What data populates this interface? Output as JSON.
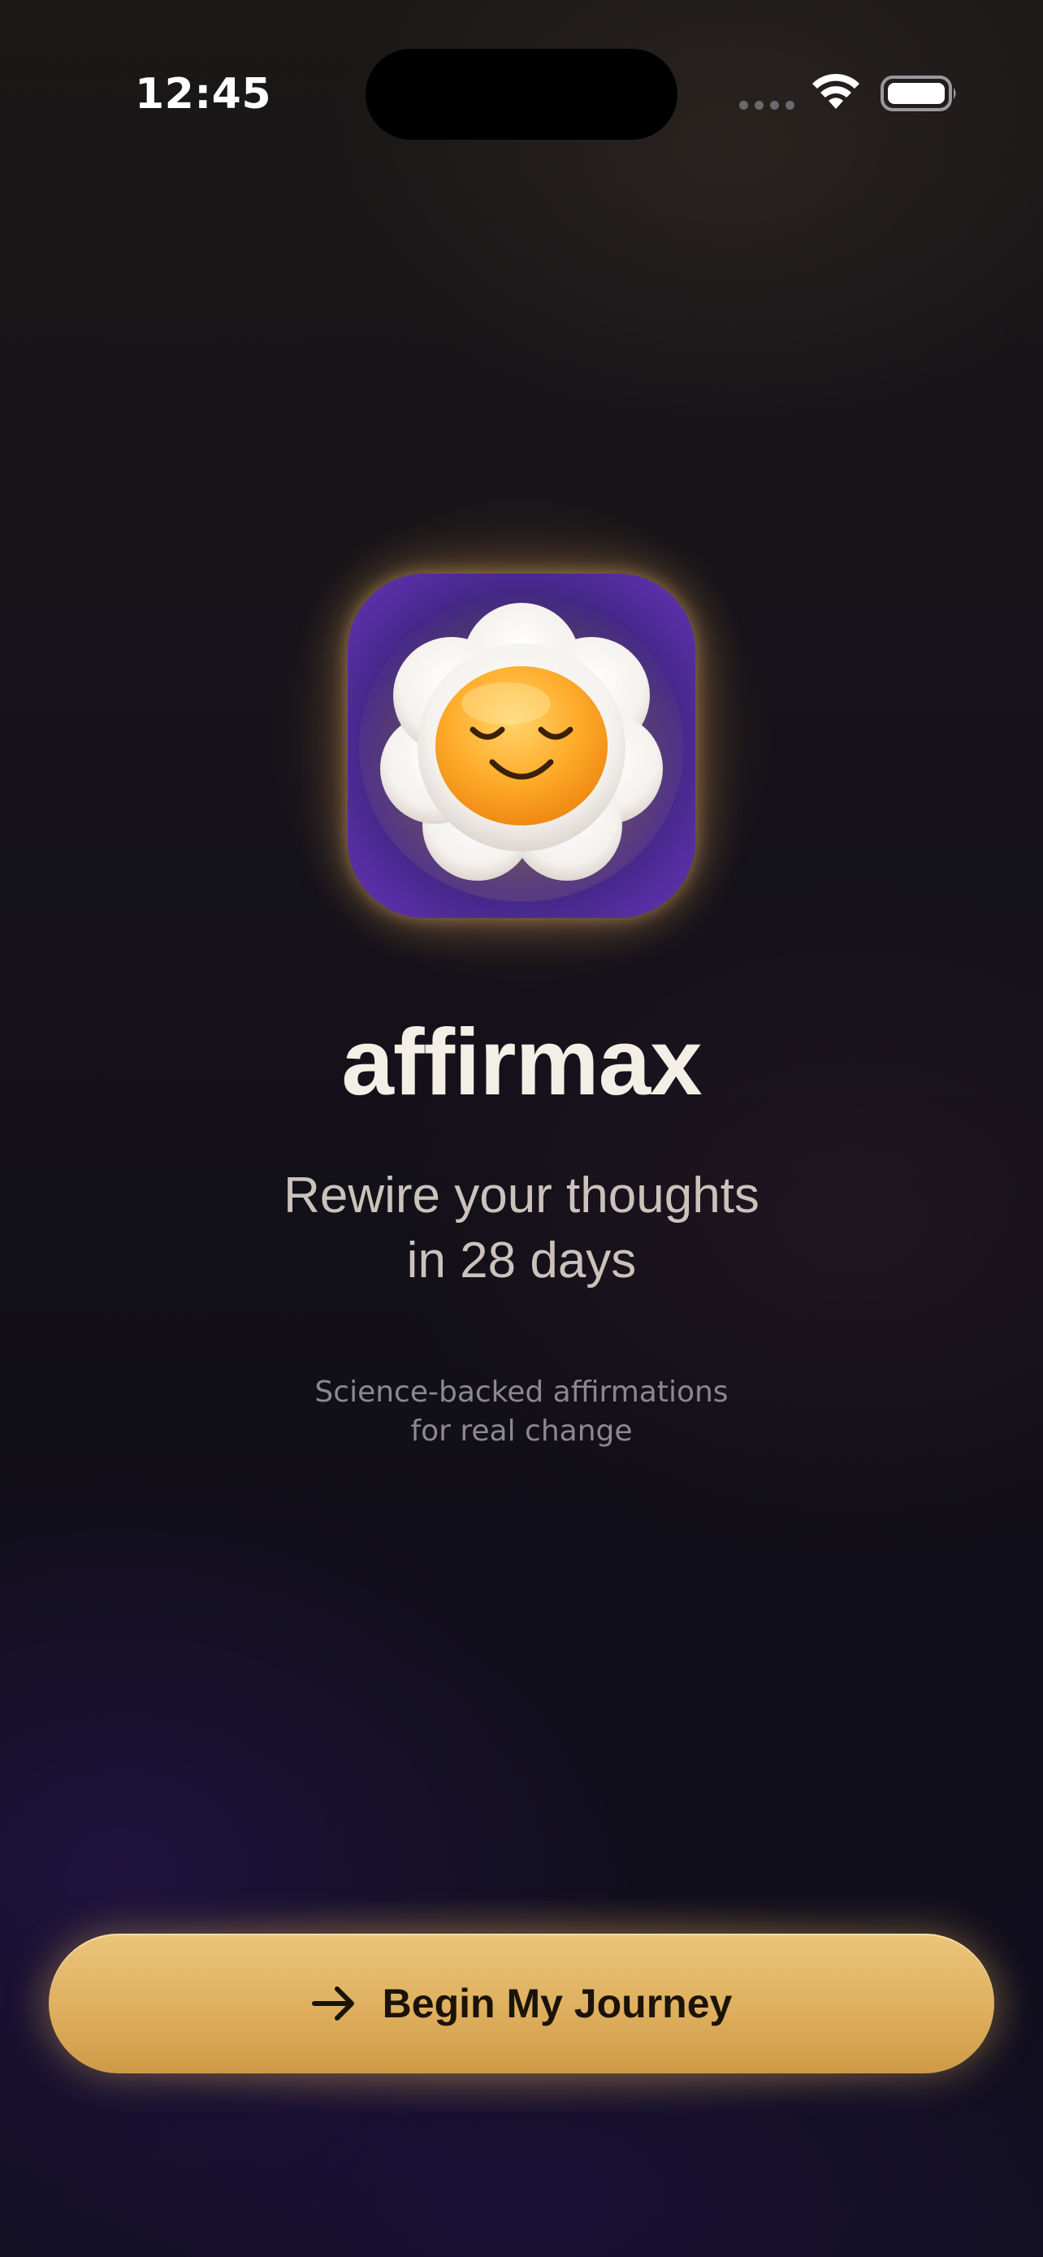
{
  "status_bar": {
    "time": "12:45",
    "icons": [
      "signal-dots-icon",
      "wifi-icon",
      "battery-icon"
    ]
  },
  "app": {
    "icon": "smiling-flower-icon",
    "name": "affirmax",
    "tagline_line1": "Rewire your thoughts",
    "tagline_line2": "in 28 days",
    "subtext_line1": "Science-backed affirmations",
    "subtext_line2": "for real change"
  },
  "cta": {
    "icon": "arrow-right-icon",
    "label": "Begin My Journey"
  },
  "colors": {
    "background": "#100e17",
    "accent_gold": "#deaf5e",
    "icon_purple": "#6a33b8",
    "title_text": "#f4efe6",
    "tagline_text": "#cbc3bb",
    "subtext": "#8c8790"
  }
}
